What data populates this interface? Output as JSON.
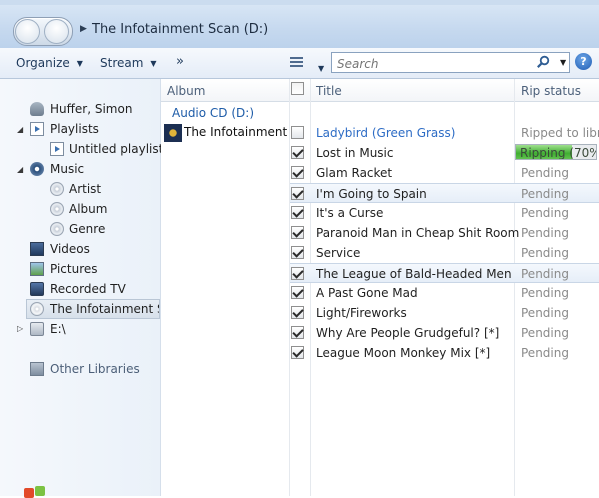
{
  "address": {
    "breadcrumb": "The Infotainment Scan (D:)"
  },
  "toolbar": {
    "organize": "Organize",
    "stream": "Stream",
    "overflow": "»"
  },
  "search": {
    "placeholder": "Search"
  },
  "help": "?",
  "nav": {
    "user": "Huffer, Simon",
    "playlists": "Playlists",
    "untitled_playlist": "Untitled playlist",
    "music": "Music",
    "artist": "Artist",
    "album": "Album",
    "genre": "Genre",
    "videos": "Videos",
    "pictures": "Pictures",
    "recorded_tv": "Recorded TV",
    "cd": "The Infotainment Sc",
    "drive": "E:\\",
    "other_libraries": "Other Libraries"
  },
  "columns": {
    "album": "Album",
    "title": "Title",
    "rip_status": "Rip status"
  },
  "group": {
    "title": "Audio CD (D:)",
    "album_name": "The Infotainment ..."
  },
  "tracks": [
    {
      "title": "Ladybird (Green Grass)",
      "checked": false,
      "status": "Ripped to library"
    },
    {
      "title": "Lost in Music",
      "checked": true,
      "status": "Ripping (70%)",
      "progress": 0.7
    },
    {
      "title": "Glam Racket",
      "checked": true,
      "status": "Pending"
    },
    {
      "title": "I'm Going to Spain",
      "checked": true,
      "status": "Pending"
    },
    {
      "title": "It's a Curse",
      "checked": true,
      "status": "Pending"
    },
    {
      "title": "Paranoid Man in Cheap Shit Room",
      "checked": true,
      "status": "Pending"
    },
    {
      "title": "Service",
      "checked": true,
      "status": "Pending"
    },
    {
      "title": "The League of Bald-Headed Men",
      "checked": true,
      "status": "Pending"
    },
    {
      "title": "A Past Gone Mad",
      "checked": true,
      "status": "Pending"
    },
    {
      "title": "Light/Fireworks",
      "checked": true,
      "status": "Pending"
    },
    {
      "title": "Why Are People Grudgeful? [*]",
      "checked": true,
      "status": "Pending"
    },
    {
      "title": "League Moon Monkey Mix [*]",
      "checked": true,
      "status": "Pending"
    }
  ],
  "colors": {
    "accent_blue": "#1e5ca8",
    "progress_green": "#3fae31",
    "status_gray": "#8a8a8a"
  }
}
